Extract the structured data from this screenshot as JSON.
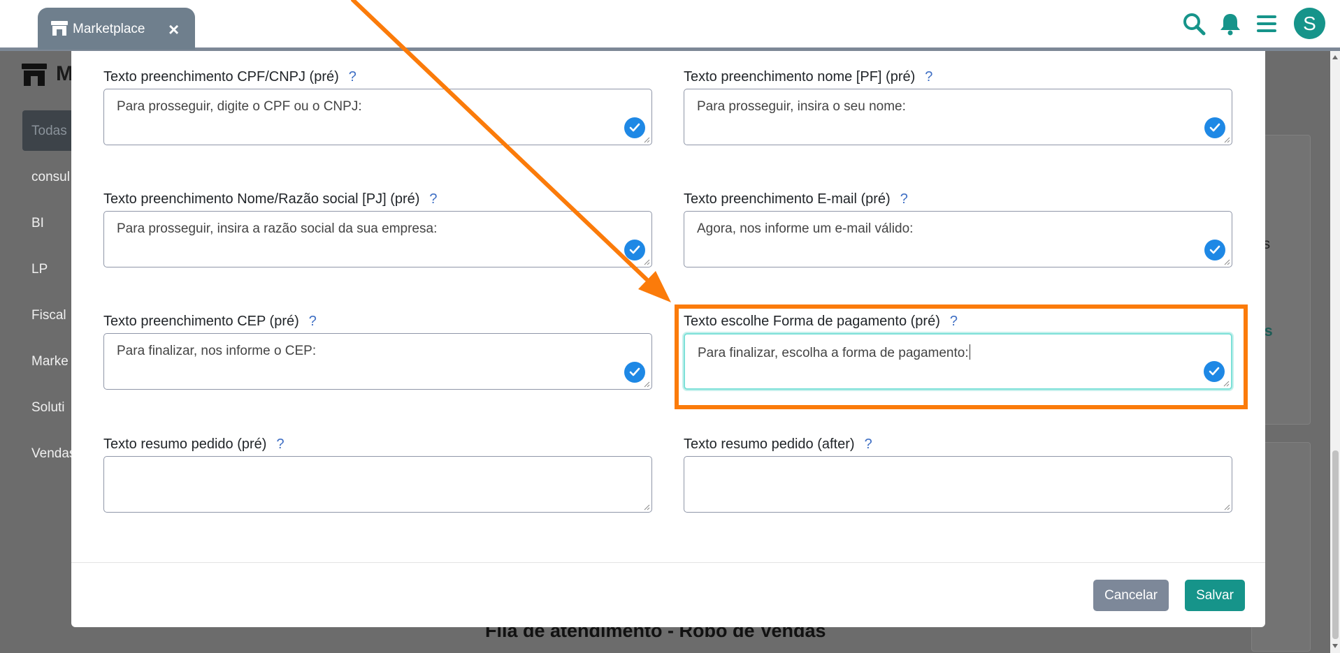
{
  "app": {
    "tab_label": "Marketplace",
    "tab_close": "×",
    "avatar_initial": "S"
  },
  "background": {
    "title_fragment": "M",
    "sidebar_items": [
      "Todas",
      "consul",
      "BI",
      "LP",
      "Fiscal",
      "Marke",
      "Soluti",
      "Vendas"
    ],
    "right_fragment_1": "es",
    "right_fragment_2": "tis",
    "bottom_title": "Fila de atendimento - Robô de Vendas"
  },
  "modal": {
    "help_mark": "?",
    "fields": [
      {
        "label": "Texto preenchimento CPF/CNPJ (pré)",
        "value": "Para prosseguir, digite o CPF ou o CNPJ:"
      },
      {
        "label": "Texto preenchimento nome [PF] (pré)",
        "value": "Para prosseguir, insira o seu nome:"
      },
      {
        "label": "Texto preenchimento Nome/Razão social [PJ] (pré)",
        "value": "Para prosseguir, insira a razão social da sua empresa:"
      },
      {
        "label": "Texto preenchimento E-mail (pré)",
        "value": "Agora, nos informe um e-mail válido:"
      },
      {
        "label": "Texto preenchimento CEP (pré)",
        "value": "Para finalizar, nos informe o CEP:"
      },
      {
        "label": "Texto escolhe Forma de pagamento (pré)",
        "value": "Para finalizar, escolha a forma de pagamento:"
      },
      {
        "label": "Texto resumo pedido (pré)",
        "value": ""
      },
      {
        "label": "Texto resumo pedido (after)",
        "value": ""
      }
    ],
    "cancel_label": "Cancelar",
    "save_label": "Salvar"
  },
  "colors": {
    "accent": "#16948a",
    "annotation": "#fb7b0a",
    "check": "#1e88e5",
    "cancel": "#7d8899"
  },
  "icons": [
    "store-icon",
    "close-icon",
    "search-icon",
    "bell-icon",
    "menu-icon",
    "check-icon"
  ]
}
